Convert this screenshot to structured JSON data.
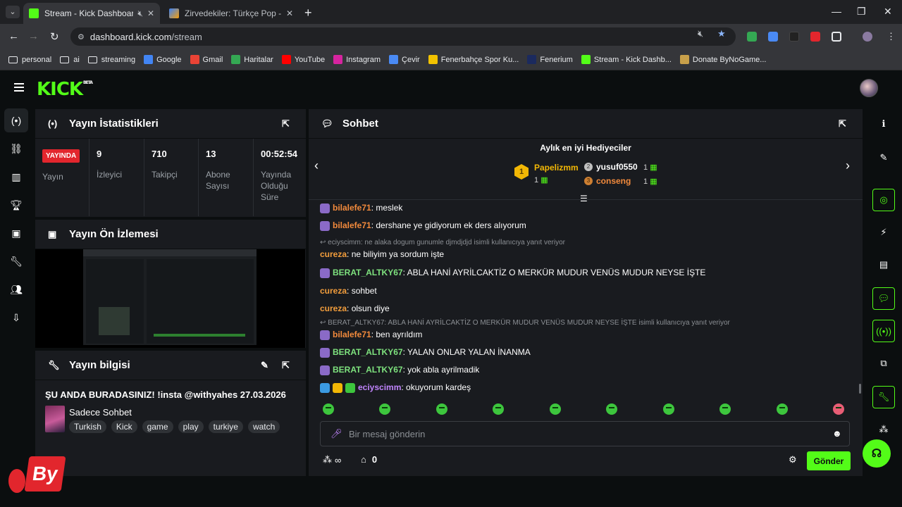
{
  "browser": {
    "tabs": [
      {
        "title": "Stream - Kick Dashboard",
        "active": true
      },
      {
        "title": "Zirvedekiler: Türkçe Pop - Music",
        "active": false
      }
    ],
    "url_host": "dashboard.kick.com",
    "url_path": "/stream",
    "bookmarks": [
      {
        "label": "personal",
        "type": "folder"
      },
      {
        "label": "ai",
        "type": "folder"
      },
      {
        "label": "streaming",
        "type": "folder"
      },
      {
        "label": "Google",
        "type": "site",
        "color": "#4285f4"
      },
      {
        "label": "Gmail",
        "type": "site",
        "color": "#ea4335"
      },
      {
        "label": "Haritalar",
        "type": "site",
        "color": "#34a853"
      },
      {
        "label": "YouTube",
        "type": "site",
        "color": "#ff0000"
      },
      {
        "label": "Instagram",
        "type": "site",
        "color": "#d6249f"
      },
      {
        "label": "Çevir",
        "type": "site",
        "color": "#4a8af4"
      },
      {
        "label": "Fenerbahçe Spor Ku...",
        "type": "site",
        "color": "#f2c200"
      },
      {
        "label": "Fenerium",
        "type": "site",
        "color": "#1b2a5e"
      },
      {
        "label": "Stream - Kick Dashb...",
        "type": "site",
        "color": "#53fc18"
      },
      {
        "label": "Donate ByNoGame...",
        "type": "site",
        "color": "#c8a04a"
      }
    ]
  },
  "app": {
    "logo": "KICK",
    "logo_beta": "BETA",
    "accent": "#53fc18"
  },
  "stats": {
    "title": "Yayın İstatistikleri",
    "live_badge": "YAYINDA",
    "live_label": "Yayın",
    "items": [
      {
        "value": "9",
        "label": "İzleyici"
      },
      {
        "value": "710",
        "label": "Takipçi"
      },
      {
        "value": "13",
        "label": "Abone Sayısı"
      },
      {
        "value": "00:52:54",
        "label": "Yayında Olduğu Süre"
      }
    ]
  },
  "preview": {
    "title": "Yayın Ön İzlemesi"
  },
  "info": {
    "title": "Yayın bilgisi",
    "stream_title": "ŞU ANDA BURADASINIZ! !insta @withyahes 27.03.2026",
    "category": "Sadece Sohbet",
    "tags": [
      "Turkish",
      "Kick",
      "game",
      "play",
      "turkiye",
      "watch"
    ]
  },
  "chat": {
    "title": "Sohbet",
    "gifters_title": "Aylık en iyi Hediyeciler",
    "gifters": [
      {
        "rank": "1",
        "name": "Papelizmm",
        "count": "1"
      },
      {
        "rank": "2",
        "name": "yusuf0550",
        "count": "1"
      },
      {
        "rank": "3",
        "name": "conseng",
        "count": "1"
      }
    ],
    "messages": [
      {
        "user": "bilalefe71",
        "text": ": meslek",
        "color": "#f28a3c",
        "badge": true
      },
      {
        "user": "bilalefe71",
        "text": ": dershane ye gidiyorum ek ders alıyorum",
        "color": "#f28a3c",
        "badge": true
      },
      {
        "reply": "eciyscimm: ne alaka dogum gunumle djmdjdjd isimli kullanıcıya yanıt veriyor"
      },
      {
        "user": "cureza",
        "text": ": ne biliyim ya sordum işte",
        "color": "#f29d3c",
        "badge": false
      },
      {
        "user": "BERAT_ALTKY67",
        "text": ": ABLA HANİ AYRİLCAKTİZ O MERKÜR MUDUR VENÜS MUDUR NEYSE İŞTE",
        "color": "#7ee27e",
        "badge": true
      },
      {
        "user": "cureza",
        "text": ": sohbet",
        "color": "#f29d3c",
        "badge": false
      },
      {
        "user": "cureza",
        "text": ": olsun diye",
        "color": "#f29d3c",
        "badge": false
      },
      {
        "reply": "BERAT_ALTKY67: ABLA HANİ AYRİLCAKTİZ O MERKÜR MUDUR VENÜS MUDUR NEYSE İŞTE isimli kullanıcıya yanıt veriyor"
      },
      {
        "user": "bilalefe71",
        "text": ": ben ayrıldım",
        "color": "#f28a3c",
        "badge": true
      },
      {
        "user": "BERAT_ALTKY67",
        "text": ": YALAN ONLAR YALAN İNANMA",
        "color": "#7ee27e",
        "badge": true
      },
      {
        "user": "BERAT_ALTKY67",
        "text": ": yok abla ayrilmadik",
        "color": "#7ee27e",
        "badge": true
      },
      {
        "user": "eciyscimm",
        "text": ": okuyorum kardeş",
        "color": "#c084fc",
        "badge": true,
        "multi_badge": true
      }
    ],
    "input_placeholder": "Bir mesaj gönderin",
    "points": "∞",
    "store_count": "0",
    "send_label": "Gönder"
  },
  "overlay": {
    "by_text": "By"
  }
}
